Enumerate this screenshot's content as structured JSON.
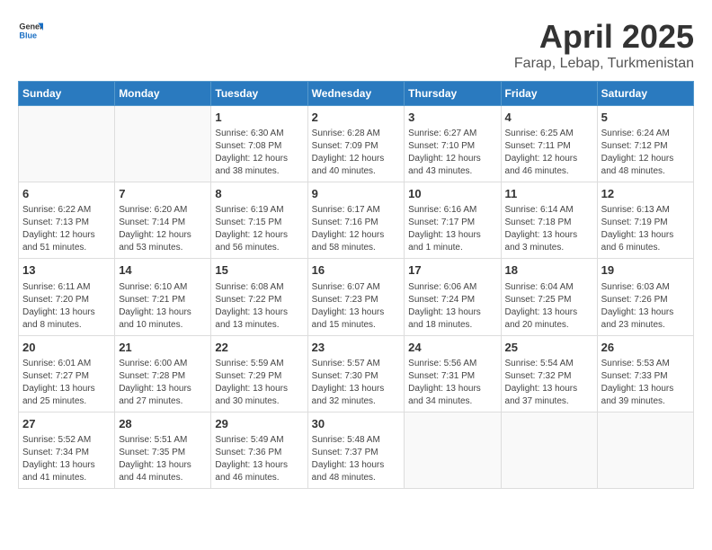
{
  "header": {
    "logo_general": "General",
    "logo_blue": "Blue",
    "main_title": "April 2025",
    "subtitle": "Farap, Lebap, Turkmenistan"
  },
  "weekdays": [
    "Sunday",
    "Monday",
    "Tuesday",
    "Wednesday",
    "Thursday",
    "Friday",
    "Saturday"
  ],
  "weeks": [
    [
      {
        "day": "",
        "detail": ""
      },
      {
        "day": "",
        "detail": ""
      },
      {
        "day": "1",
        "detail": "Sunrise: 6:30 AM\nSunset: 7:08 PM\nDaylight: 12 hours and 38 minutes."
      },
      {
        "day": "2",
        "detail": "Sunrise: 6:28 AM\nSunset: 7:09 PM\nDaylight: 12 hours and 40 minutes."
      },
      {
        "day": "3",
        "detail": "Sunrise: 6:27 AM\nSunset: 7:10 PM\nDaylight: 12 hours and 43 minutes."
      },
      {
        "day": "4",
        "detail": "Sunrise: 6:25 AM\nSunset: 7:11 PM\nDaylight: 12 hours and 46 minutes."
      },
      {
        "day": "5",
        "detail": "Sunrise: 6:24 AM\nSunset: 7:12 PM\nDaylight: 12 hours and 48 minutes."
      }
    ],
    [
      {
        "day": "6",
        "detail": "Sunrise: 6:22 AM\nSunset: 7:13 PM\nDaylight: 12 hours and 51 minutes."
      },
      {
        "day": "7",
        "detail": "Sunrise: 6:20 AM\nSunset: 7:14 PM\nDaylight: 12 hours and 53 minutes."
      },
      {
        "day": "8",
        "detail": "Sunrise: 6:19 AM\nSunset: 7:15 PM\nDaylight: 12 hours and 56 minutes."
      },
      {
        "day": "9",
        "detail": "Sunrise: 6:17 AM\nSunset: 7:16 PM\nDaylight: 12 hours and 58 minutes."
      },
      {
        "day": "10",
        "detail": "Sunrise: 6:16 AM\nSunset: 7:17 PM\nDaylight: 13 hours and 1 minute."
      },
      {
        "day": "11",
        "detail": "Sunrise: 6:14 AM\nSunset: 7:18 PM\nDaylight: 13 hours and 3 minutes."
      },
      {
        "day": "12",
        "detail": "Sunrise: 6:13 AM\nSunset: 7:19 PM\nDaylight: 13 hours and 6 minutes."
      }
    ],
    [
      {
        "day": "13",
        "detail": "Sunrise: 6:11 AM\nSunset: 7:20 PM\nDaylight: 13 hours and 8 minutes."
      },
      {
        "day": "14",
        "detail": "Sunrise: 6:10 AM\nSunset: 7:21 PM\nDaylight: 13 hours and 10 minutes."
      },
      {
        "day": "15",
        "detail": "Sunrise: 6:08 AM\nSunset: 7:22 PM\nDaylight: 13 hours and 13 minutes."
      },
      {
        "day": "16",
        "detail": "Sunrise: 6:07 AM\nSunset: 7:23 PM\nDaylight: 13 hours and 15 minutes."
      },
      {
        "day": "17",
        "detail": "Sunrise: 6:06 AM\nSunset: 7:24 PM\nDaylight: 13 hours and 18 minutes."
      },
      {
        "day": "18",
        "detail": "Sunrise: 6:04 AM\nSunset: 7:25 PM\nDaylight: 13 hours and 20 minutes."
      },
      {
        "day": "19",
        "detail": "Sunrise: 6:03 AM\nSunset: 7:26 PM\nDaylight: 13 hours and 23 minutes."
      }
    ],
    [
      {
        "day": "20",
        "detail": "Sunrise: 6:01 AM\nSunset: 7:27 PM\nDaylight: 13 hours and 25 minutes."
      },
      {
        "day": "21",
        "detail": "Sunrise: 6:00 AM\nSunset: 7:28 PM\nDaylight: 13 hours and 27 minutes."
      },
      {
        "day": "22",
        "detail": "Sunrise: 5:59 AM\nSunset: 7:29 PM\nDaylight: 13 hours and 30 minutes."
      },
      {
        "day": "23",
        "detail": "Sunrise: 5:57 AM\nSunset: 7:30 PM\nDaylight: 13 hours and 32 minutes."
      },
      {
        "day": "24",
        "detail": "Sunrise: 5:56 AM\nSunset: 7:31 PM\nDaylight: 13 hours and 34 minutes."
      },
      {
        "day": "25",
        "detail": "Sunrise: 5:54 AM\nSunset: 7:32 PM\nDaylight: 13 hours and 37 minutes."
      },
      {
        "day": "26",
        "detail": "Sunrise: 5:53 AM\nSunset: 7:33 PM\nDaylight: 13 hours and 39 minutes."
      }
    ],
    [
      {
        "day": "27",
        "detail": "Sunrise: 5:52 AM\nSunset: 7:34 PM\nDaylight: 13 hours and 41 minutes."
      },
      {
        "day": "28",
        "detail": "Sunrise: 5:51 AM\nSunset: 7:35 PM\nDaylight: 13 hours and 44 minutes."
      },
      {
        "day": "29",
        "detail": "Sunrise: 5:49 AM\nSunset: 7:36 PM\nDaylight: 13 hours and 46 minutes."
      },
      {
        "day": "30",
        "detail": "Sunrise: 5:48 AM\nSunset: 7:37 PM\nDaylight: 13 hours and 48 minutes."
      },
      {
        "day": "",
        "detail": ""
      },
      {
        "day": "",
        "detail": ""
      },
      {
        "day": "",
        "detail": ""
      }
    ]
  ]
}
